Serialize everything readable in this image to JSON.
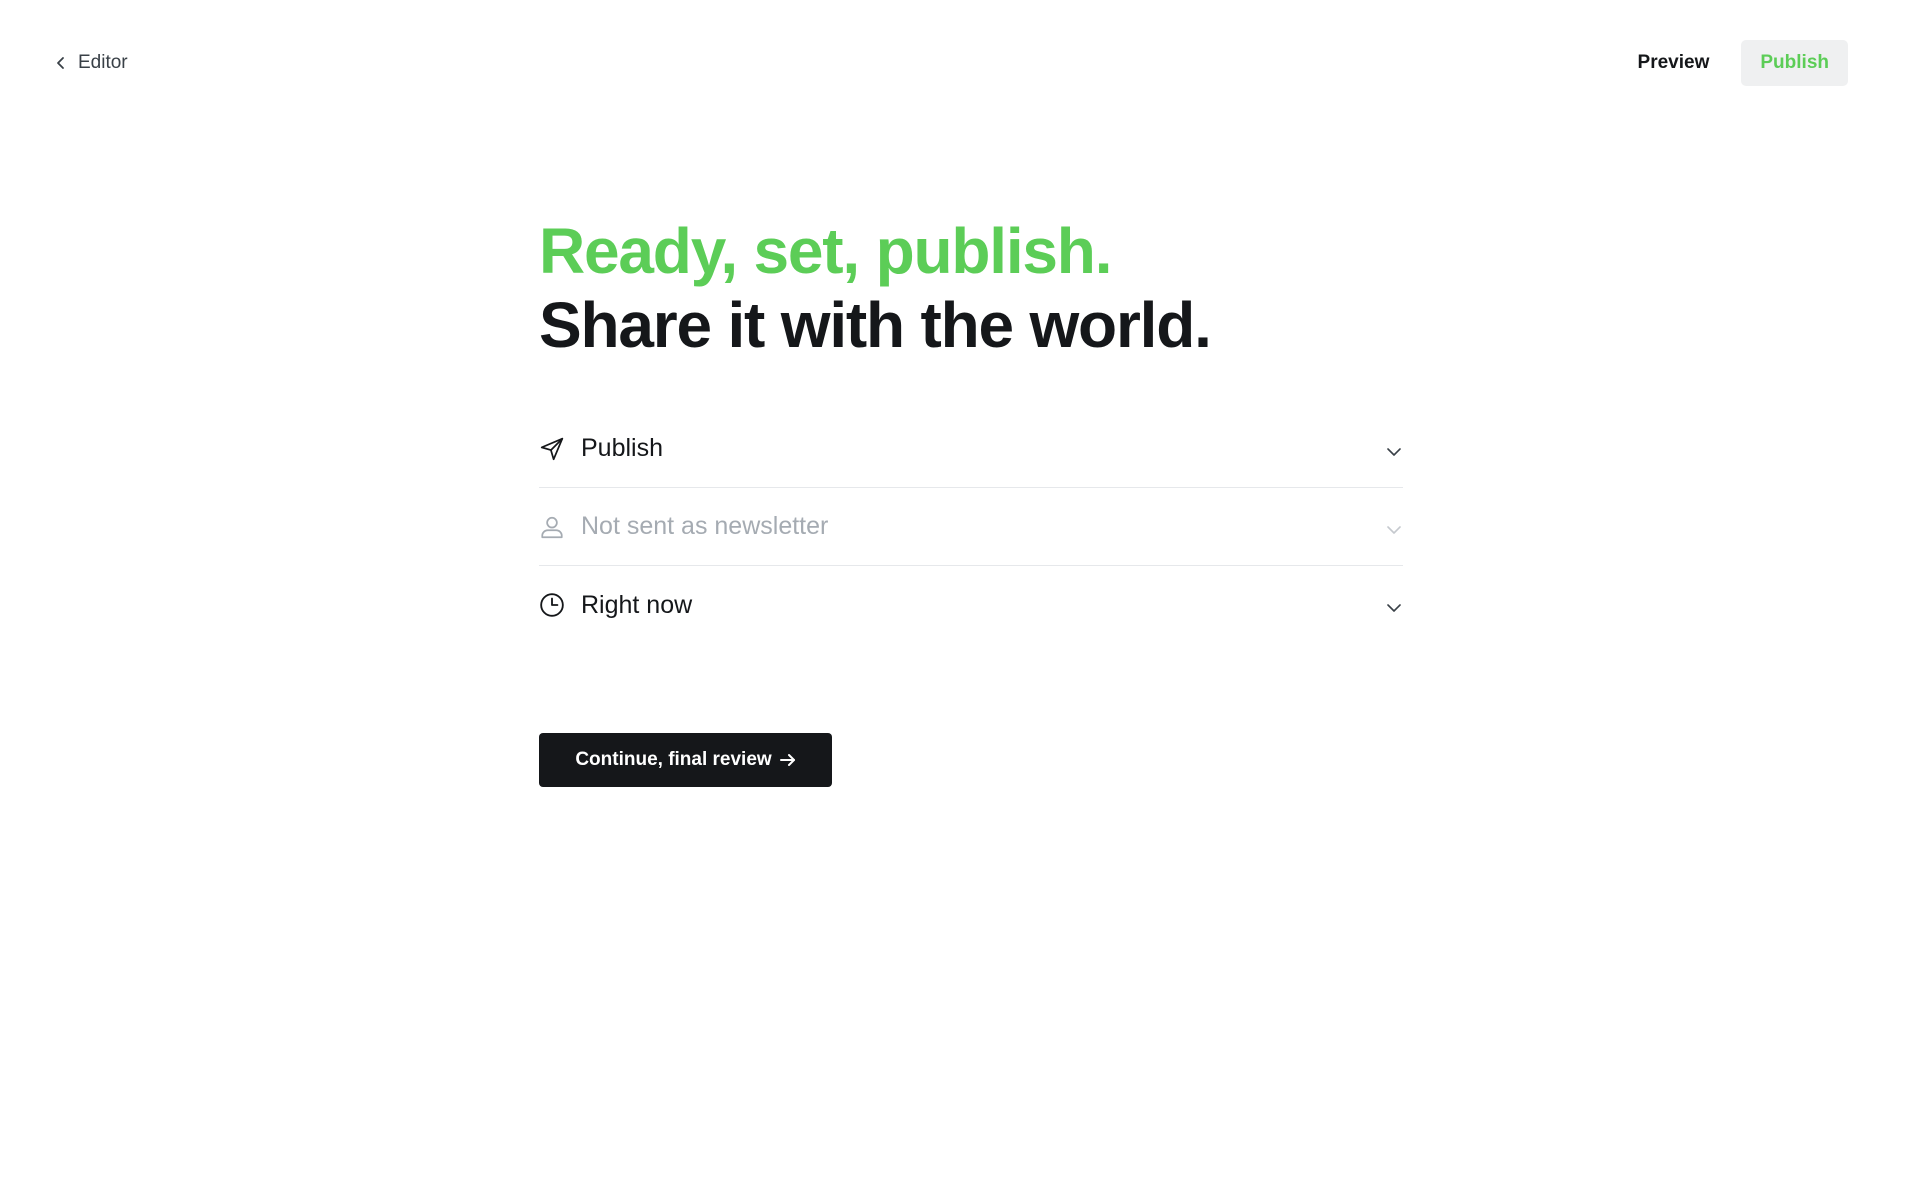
{
  "topbar": {
    "back_label": "Editor",
    "preview_label": "Preview",
    "publish_label": "Publish"
  },
  "headline": {
    "line1": "Ready, set, publish.",
    "line2": "Share it with the world."
  },
  "options": [
    {
      "label": "Publish",
      "icon": "paper-plane-icon",
      "muted": false
    },
    {
      "label": "Not sent as newsletter",
      "icon": "user-icon",
      "muted": true
    },
    {
      "label": "Right now",
      "icon": "clock-icon",
      "muted": false
    }
  ],
  "continue_label": "Continue, final review",
  "colors": {
    "accent_green": "#5ccd57",
    "dark": "#15171a",
    "muted": "#a5abb2"
  }
}
